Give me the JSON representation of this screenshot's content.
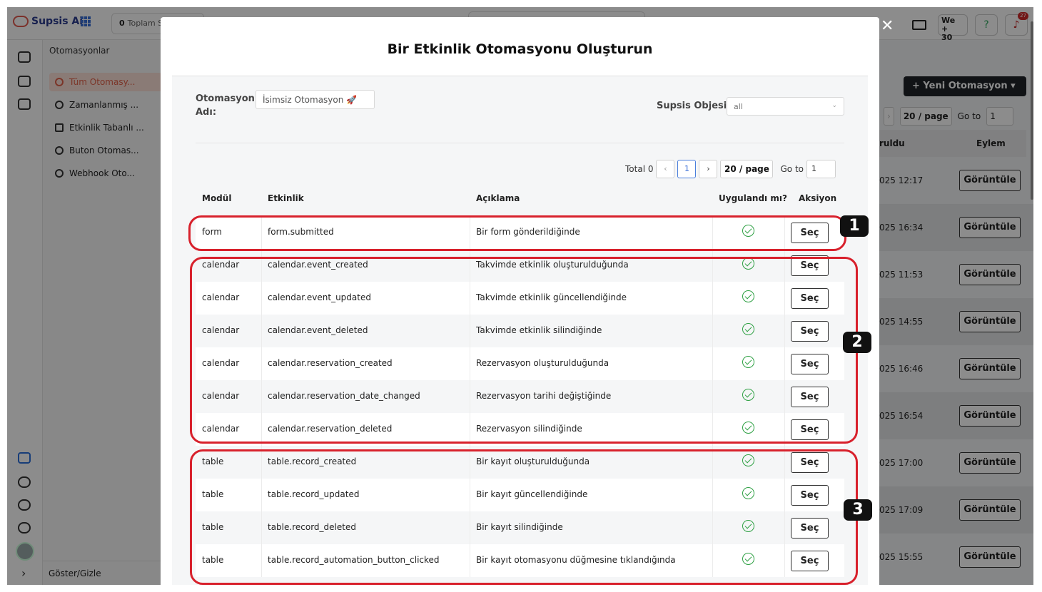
{
  "app": {
    "logo_text": "Supsis Ai",
    "total_count": "0",
    "total_label": "Toplam S",
    "we_label": "We",
    "we_count": "30",
    "notification_count": "27",
    "help_label": "?"
  },
  "sidebar": {
    "title": "Otomasyonlar",
    "items": [
      {
        "label": "Tüm Otomasy..."
      },
      {
        "label": "Zamanlanmış ..."
      },
      {
        "label": "Etkinlik Tabanlı ..."
      },
      {
        "label": "Buton Otomas..."
      },
      {
        "label": "Webhook Oto..."
      }
    ],
    "footer": "Göster/Gizle"
  },
  "background_table": {
    "new_button": "Yeni Otomasyon",
    "page_size": "20 / page",
    "goto_label": "Go to",
    "goto_value": "1",
    "col_date": "ruldu",
    "col_action": "Eylem",
    "rows": [
      {
        "date": "025 12:17",
        "action": "Görüntüle"
      },
      {
        "date": "025 16:34",
        "action": "Görüntüle"
      },
      {
        "date": "025 11:53",
        "action": "Görüntüle"
      },
      {
        "date": "025 14:55",
        "action": "Görüntüle"
      },
      {
        "date": "025 16:46",
        "action": "Görüntüle"
      },
      {
        "date": "025 16:54",
        "action": "Görüntüle"
      },
      {
        "date": "025 17:00",
        "action": "Görüntüle"
      },
      {
        "date": "025 17:09",
        "action": "Görüntüle"
      },
      {
        "date": "025 15:55",
        "action": "Görüntüle"
      }
    ]
  },
  "modal": {
    "title": "Bir Etkinlik Otomasyonu Oluşturun",
    "name_label_line1": "Otomasyon",
    "name_label_line2": "Adı:",
    "name_value": "İsimsiz Otomasyon 🚀",
    "object_label": "Supsis Objesi:",
    "object_value": "all",
    "pager": {
      "total": "Total 0",
      "prev": "‹",
      "page": "1",
      "next": "›",
      "size": "20 / page",
      "goto_label": "Go to",
      "goto_value": "1"
    },
    "columns": {
      "module": "Modül",
      "event": "Etkinlik",
      "description": "Açıklama",
      "applied": "Uygulandı mı?",
      "action": "Aksiyon"
    },
    "rows": [
      {
        "module": "form",
        "event": "form.submitted",
        "description": "Bir form gönderildiğinde",
        "button": "Seç"
      },
      {
        "module": "calendar",
        "event": "calendar.event_created",
        "description": "Takvimde etkinlik oluşturulduğunda",
        "button": "Seç"
      },
      {
        "module": "calendar",
        "event": "calendar.event_updated",
        "description": "Takvimde etkinlik güncellendiğinde",
        "button": "Seç"
      },
      {
        "module": "calendar",
        "event": "calendar.event_deleted",
        "description": "Takvimde etkinlik silindiğinde",
        "button": "Seç"
      },
      {
        "module": "calendar",
        "event": "calendar.reservation_created",
        "description": "Rezervasyon oluşturulduğunda",
        "button": "Seç"
      },
      {
        "module": "calendar",
        "event": "calendar.reservation_date_changed",
        "description": "Rezervasyon tarihi değiştiğinde",
        "button": "Seç"
      },
      {
        "module": "calendar",
        "event": "calendar.reservation_deleted",
        "description": "Rezervasyon silindiğinde",
        "button": "Seç"
      },
      {
        "module": "table",
        "event": "table.record_created",
        "description": "Bir kayıt oluşturulduğunda",
        "button": "Seç"
      },
      {
        "module": "table",
        "event": "table.record_updated",
        "description": "Bir kayıt güncellendiğinde",
        "button": "Seç"
      },
      {
        "module": "table",
        "event": "table.record_deleted",
        "description": "Bir kayıt silindiğinde",
        "button": "Seç"
      },
      {
        "module": "table",
        "event": "table.record_automation_button_clicked",
        "description": "Bir kayıt otomasyonu düğmesine tıklandığında",
        "button": "Seç"
      }
    ]
  },
  "annotations": {
    "labels": [
      "1",
      "2",
      "3"
    ],
    "color": "#d8212c"
  }
}
